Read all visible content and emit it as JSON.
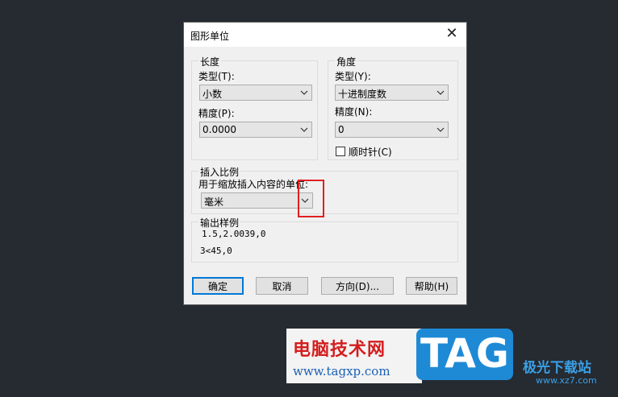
{
  "dialog": {
    "title": "图形单位",
    "close_glyph": "✕",
    "length": {
      "group_title": "长度",
      "type_label": "类型(T):",
      "type_value": "小数",
      "precision_label": "精度(P):",
      "precision_value": "0.0000"
    },
    "angle": {
      "group_title": "角度",
      "type_label": "类型(Y):",
      "type_value": "十进制度数",
      "precision_label": "精度(N):",
      "precision_value": "0",
      "clockwise_label": "顺时针(C)"
    },
    "insert_scale": {
      "group_title": "插入比例",
      "units_label": "用于缩放插入内容的单位:",
      "units_value": "毫米"
    },
    "sample_output": {
      "group_title": "输出样例",
      "line1": "1.5,2.0039,0",
      "line2": "3<45,0"
    },
    "buttons": {
      "ok": "确定",
      "cancel": "取消",
      "direction": "方向(D)...",
      "help": "帮助(H)"
    }
  },
  "watermark": {
    "site_name": "电脑技术网",
    "site_url": "www.tagxp.com",
    "logo_text": "TAG",
    "site2_name": "极光下载站",
    "site2_url": "www.xz7.com"
  },
  "colors": {
    "background": "#262a31",
    "dialog_bg": "#f0f0f0",
    "default_button_border": "#0078d7",
    "highlight": "#e02020",
    "logo_bg": "#1e8ad6"
  }
}
